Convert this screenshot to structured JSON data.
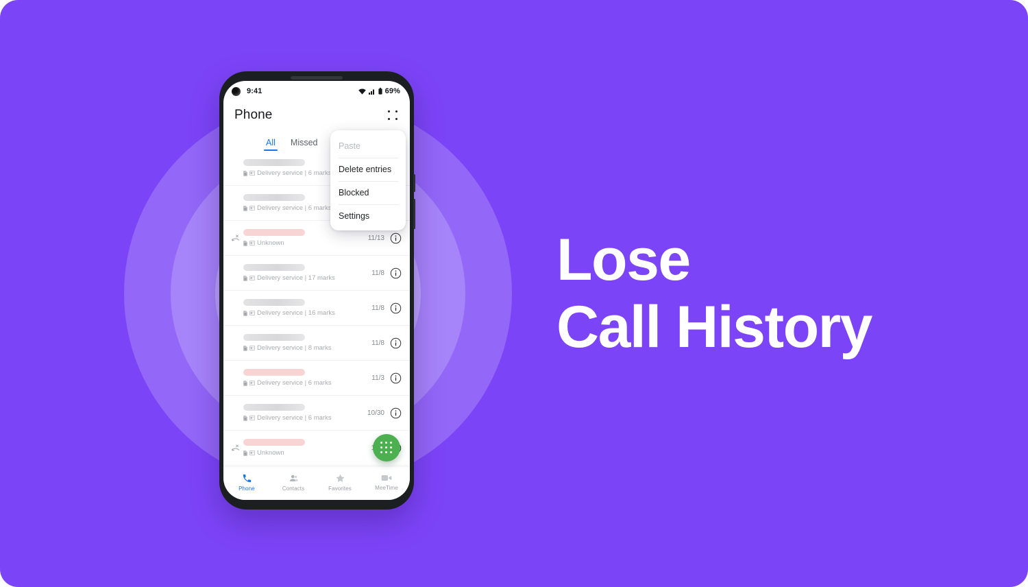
{
  "theme": {
    "background": "#7c44f7",
    "ring_outer": "#9367f8",
    "ring_mid": "#a684fa",
    "ring_inner": "#bba2fb",
    "accent_blue": "#1a73e8",
    "fab_green": "#4caf50",
    "headline_color": "#ffffff"
  },
  "headline": {
    "line1": "Lose",
    "line2": "Call History"
  },
  "phone": {
    "status_bar": {
      "time": "9:41",
      "battery_percent": "69%",
      "icons": [
        "wifi-icon",
        "cellular-signal-icon",
        "battery-icon"
      ]
    },
    "app_bar": {
      "title": "Phone",
      "overflow_icon": "grid-dots-menu-icon"
    },
    "tabs": [
      {
        "label": "All",
        "active": true
      },
      {
        "label": "Missed",
        "active": false
      }
    ],
    "dropdown_menu": {
      "items": [
        {
          "label": "Paste",
          "disabled": true
        },
        {
          "label": "Delete entries",
          "disabled": false
        },
        {
          "label": "Blocked",
          "disabled": false
        },
        {
          "label": "Settings",
          "disabled": false
        }
      ]
    },
    "call_list": [
      {
        "name_redacted": true,
        "pill": "grey",
        "status_icon": "",
        "subtitle": "Delivery service | 6 marks",
        "date": "",
        "show_meta": false
      },
      {
        "name_redacted": true,
        "pill": "grey",
        "status_icon": "",
        "subtitle": "Delivery service | 6 marks",
        "date": "",
        "show_meta": false
      },
      {
        "name_redacted": true,
        "pill": "pink",
        "status_icon": "missed-call-icon",
        "subtitle": "Unknown",
        "date": "11/13",
        "show_meta": true
      },
      {
        "name_redacted": true,
        "pill": "grey",
        "status_icon": "",
        "subtitle": "Delivery service | 17 marks",
        "date": "11/8",
        "show_meta": true
      },
      {
        "name_redacted": true,
        "pill": "grey",
        "status_icon": "",
        "subtitle": "Delivery service | 16 marks",
        "date": "11/8",
        "show_meta": true
      },
      {
        "name_redacted": true,
        "pill": "grey",
        "status_icon": "",
        "subtitle": "Delivery service | 8 marks",
        "date": "11/8",
        "show_meta": true
      },
      {
        "name_redacted": true,
        "pill": "pink",
        "status_icon": "",
        "subtitle": "Delivery service | 6 marks",
        "date": "11/3",
        "show_meta": true
      },
      {
        "name_redacted": true,
        "pill": "grey",
        "status_icon": "",
        "subtitle": "Delivery service | 6 marks",
        "date": "10/30",
        "show_meta": true
      },
      {
        "name_redacted": true,
        "pill": "pink",
        "status_icon": "missed-call-icon",
        "subtitle": "Unknown",
        "date": "10/2",
        "show_meta": true
      }
    ],
    "fab": {
      "icon": "dialpad-icon"
    },
    "bottom_nav": [
      {
        "label": "Phone",
        "icon": "phone-icon",
        "active": true
      },
      {
        "label": "Contacts",
        "icon": "contacts-icon",
        "active": false
      },
      {
        "label": "Favorites",
        "icon": "star-icon",
        "active": false
      },
      {
        "label": "MeeTime",
        "icon": "video-call-icon",
        "active": false
      }
    ]
  }
}
